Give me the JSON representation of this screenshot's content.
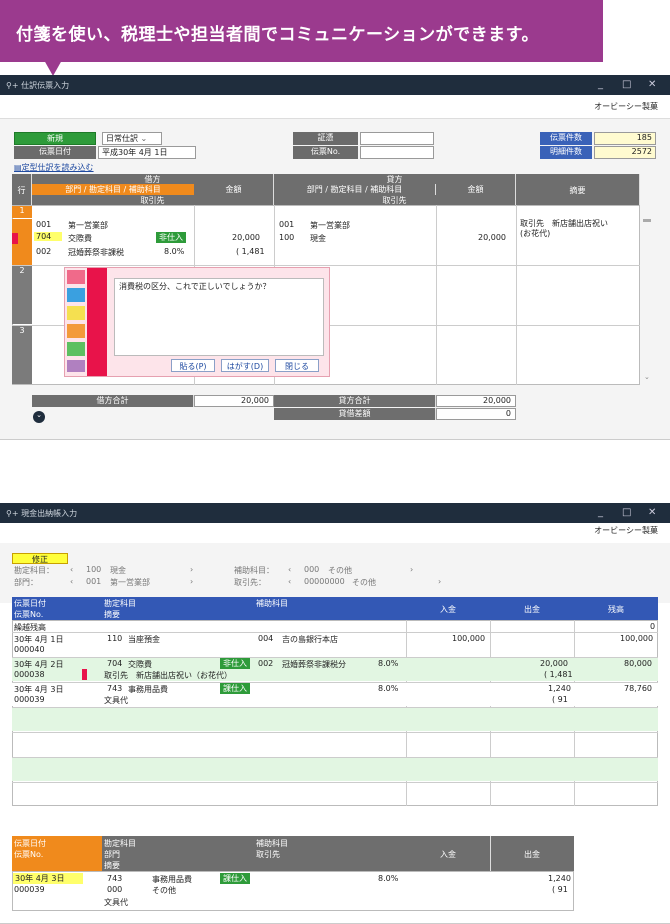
{
  "banner": {
    "text": "付箋を使い、税理士や担当者間でコミュニケーションができます。"
  },
  "window1": {
    "title": "仕訳伝票入力",
    "company": "オービーシー製菓",
    "new_label": "新規",
    "journal_type": "日常仕訳",
    "journal_type_caret": "⌄",
    "date_label": "伝票日付",
    "date_value": "平成30年 4月 1日",
    "evidence_label": "証憑",
    "slip_no_label": "伝票No.",
    "count_label": "伝票件数",
    "count_value": "185",
    "detail_count_label": "明細件数",
    "detail_count_value": "2572",
    "load_template": "定型仕訳を読み込む",
    "hdr": {
      "row": "行",
      "debit": "借方",
      "credit": "貸方",
      "dept_account": "部門 / 勘定科目 / 補助科目",
      "amount": "金額",
      "partner": "取引先",
      "summary": "摘要"
    },
    "row1": {
      "no": "1",
      "d_dept": "001",
      "d_dept_name": "第一営業部",
      "d_acct": "704",
      "d_acct_name": "交際費",
      "d_tag": "非仕入",
      "d_amount": "20,000",
      "d_sub": "002",
      "d_sub_name": "冠婚葬祭非課税",
      "d_rate": "8.0%",
      "d_tax": "( 1,481",
      "c_dept": "001",
      "c_dept_name": "第一営業部",
      "c_acct": "100",
      "c_acct_name": "現金",
      "c_amount": "20,000",
      "summary": "取引先　新店舗出店祝い　(お花代)"
    },
    "row2": {
      "no": "2"
    },
    "row3": {
      "no": "3"
    },
    "totals": {
      "debit_label": "借方合計",
      "debit_value": "20,000",
      "credit_label": "貸方合計",
      "credit_value": "20,000",
      "diff_label": "貸借差額",
      "diff_value": "0"
    },
    "sticky": {
      "text": "消費税の区分、これで正しいでしょうか？",
      "paste": "貼る(P)",
      "remove": "はがす(D)",
      "close": "閉じる",
      "colors": [
        "#f06a8a",
        "#3aa0e0",
        "#f5e050",
        "#f39a3a",
        "#5cc060",
        "#b080c0"
      ]
    }
  },
  "window2": {
    "title": "現金出納帳入力",
    "company": "オービーシー製菓",
    "mode_label": "修正",
    "filter": {
      "account_label": "勘定科目：",
      "account_code": "100",
      "account_name": "現金",
      "dept_label": "部門：",
      "dept_code": "001",
      "dept_name": "第一営業部",
      "sub_label": "補助科目：",
      "sub_code": "000",
      "sub_name": "その他",
      "partner_label": "取引先：",
      "partner_code": "00000000",
      "partner_name": "その他"
    },
    "hdr": {
      "date": "伝票日付",
      "slip": "伝票No.",
      "account": "勘定科目",
      "summary": "摘要",
      "sub": "補助科目",
      "in": "入金",
      "out": "出金",
      "balance": "残高"
    },
    "carry": {
      "label": "繰越残高",
      "balance": "0"
    },
    "rows": [
      {
        "date": "30年  4月  1日",
        "no": "000040",
        "acct": "110",
        "acct_name": "当座預金",
        "sub": "004",
        "sub_name": "吉の島銀行本店",
        "tag": "",
        "rate": "",
        "in": "100,000",
        "out": "",
        "tax": "",
        "balance": "100,000",
        "summary": ""
      },
      {
        "date": "30年  4月  2日",
        "no": "000038",
        "acct": "704",
        "acct_name": "交際費",
        "sub": "002",
        "sub_name": "冠婚葬祭非課税分",
        "tag": "非仕入",
        "rate": "8.0%",
        "in": "",
        "out": "20,000",
        "tax": "( 1,481",
        "balance": "80,000",
        "summary": "取引先　新店舗出店祝い（お花代）"
      },
      {
        "date": "30年  4月  3日",
        "no": "000039",
        "acct": "743",
        "acct_name": "事務用品費",
        "sub": "",
        "sub_name": "",
        "tag": "課仕入",
        "rate": "8.0%",
        "in": "",
        "out": "1,240",
        "tax": "( 91",
        "balance": "78,760",
        "summary": "文具代"
      }
    ],
    "footer": {
      "date_label": "伝票日付",
      "slip_label": "伝票No.",
      "account_label": "勘定科目",
      "dept_label": "部門",
      "summary_label": "摘要",
      "sub_label": "補助科目",
      "partner_label": "取引先",
      "in_label": "入金",
      "out_label": "出金",
      "date": "30年  4月  3日",
      "no": "000039",
      "acct": "743",
      "acct_name": "事務用品費",
      "tag": "課仕入",
      "dept": "000",
      "dept_name": "その他",
      "rate": "8.0%",
      "out": "1,240",
      "tax": "( 91",
      "summary": "文具代"
    }
  }
}
